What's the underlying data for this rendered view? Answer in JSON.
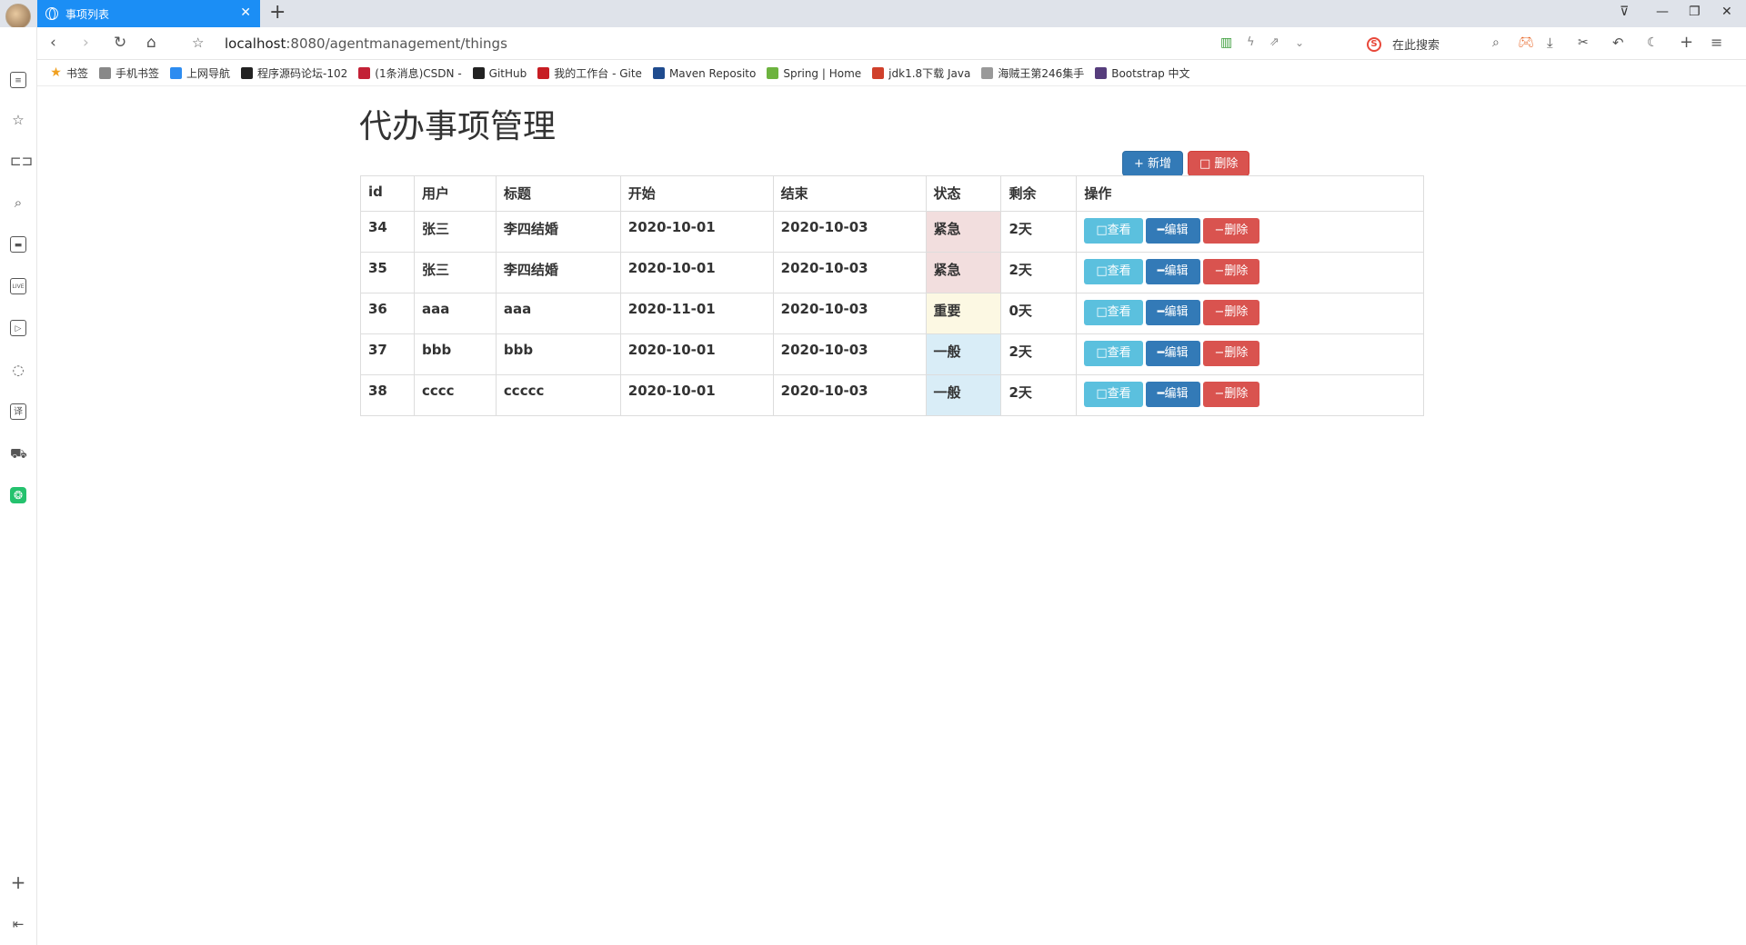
{
  "browser": {
    "tab_title": "事项列表",
    "url_host": "localhost",
    "url_rest": ":8080/agentmanagement/things",
    "search_placeholder": "在此搜索",
    "bookmarks": [
      {
        "label": "书签",
        "icon": "star-icon",
        "color": "#f0a020"
      },
      {
        "label": "手机书签",
        "icon": "phone-icon",
        "color": "#888888"
      },
      {
        "label": "上网导航",
        "icon": "nav-icon",
        "color": "#2d8cf0"
      },
      {
        "label": "程序源码论坛-102",
        "icon": "forum-icon",
        "color": "#222222"
      },
      {
        "label": "(1条消息)CSDN -",
        "icon": "csdn-icon",
        "color": "#c32136"
      },
      {
        "label": "GitHub",
        "icon": "github-icon",
        "color": "#222222"
      },
      {
        "label": "我的工作台 - Gite",
        "icon": "gitee-icon",
        "color": "#c71d23"
      },
      {
        "label": "Maven Reposito",
        "icon": "maven-icon",
        "color": "#1f4b8e"
      },
      {
        "label": "Spring | Home",
        "icon": "spring-icon",
        "color": "#6db33f"
      },
      {
        "label": "jdk1.8下载 Java",
        "icon": "jdk-icon",
        "color": "#d0402b"
      },
      {
        "label": "海贼王第246集手",
        "icon": "video-icon",
        "color": "#999999"
      },
      {
        "label": "Bootstrap 中文",
        "icon": "bootstrap-icon",
        "color": "#563d7c"
      }
    ]
  },
  "page": {
    "title": "代办事项管理",
    "add_button": "+ 新增",
    "delete_button": "删除",
    "columns": [
      "id",
      "用户",
      "标题",
      "开始",
      "结束",
      "状态",
      "剩余",
      "操作"
    ],
    "rows": [
      {
        "id": "34",
        "user": "张三",
        "title": "李四结婚",
        "start": "2020-10-01",
        "end": "2020-10-03",
        "status": "紧急",
        "status_class": "danger",
        "remain": "2天"
      },
      {
        "id": "35",
        "user": "张三",
        "title": "李四结婚",
        "start": "2020-10-01",
        "end": "2020-10-03",
        "status": "紧急",
        "status_class": "danger",
        "remain": "2天"
      },
      {
        "id": "36",
        "user": "aaa",
        "title": "aaa",
        "start": "2020-11-01",
        "end": "2020-10-03",
        "status": "重要",
        "status_class": "warning",
        "remain": "0天"
      },
      {
        "id": "37",
        "user": "bbb",
        "title": "bbb",
        "start": "2020-10-01",
        "end": "2020-10-03",
        "status": "一般",
        "status_class": "info",
        "remain": "2天"
      },
      {
        "id": "38",
        "user": "cccc",
        "title": "ccccc",
        "start": "2020-10-01",
        "end": "2020-10-03",
        "status": "一般",
        "status_class": "info",
        "remain": "2天"
      }
    ],
    "row_actions": {
      "view": "查看",
      "edit": "编辑",
      "delete": "删除"
    }
  }
}
